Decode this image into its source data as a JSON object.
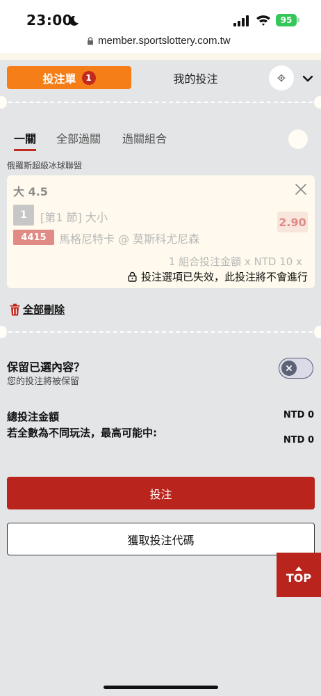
{
  "status_bar": {
    "time": "23:00",
    "battery": "95"
  },
  "browser": {
    "url": "member.sportslottery.com.tw"
  },
  "header": {
    "betslip_tab": "投注單",
    "betslip_count": "1",
    "mybets_tab": "我的投注"
  },
  "bet_tabs": [
    {
      "label": "一關",
      "active": true
    },
    {
      "label": "全部過關",
      "active": false
    },
    {
      "label": "過關組合",
      "active": false
    }
  ],
  "league": "俄羅斯超級冰球聯盟",
  "bet": {
    "selection": "大 4.5",
    "period_badge": "1",
    "period_text": "[第1 節] 大小",
    "odds": "2.90",
    "match_code": "4415",
    "teams": "馬格尼特卡 @ 莫斯科尤尼森",
    "combo_summary": "1 組合投注金額 x NTD 10 x",
    "invalid_notice": "投注選項已失效，此投注將不會進行"
  },
  "delete_all": "全部刪除",
  "keep": {
    "title": "保留已選內容？",
    "subtitle": "您的投注將被保留"
  },
  "summary": {
    "total_label": "總投注金額",
    "total_value": "NTD 0",
    "max_win_label": "若全數為不同玩法，最高可能中:",
    "max_win_value": "NTD 0"
  },
  "buttons": {
    "place_bet": "投注",
    "get_code": "獲取投注代碼",
    "top": "TOP"
  },
  "colors": {
    "accent_orange": "#f57e18",
    "brand_red": "#b9251c",
    "background": "#e4e5e7",
    "card": "#fffaed"
  }
}
